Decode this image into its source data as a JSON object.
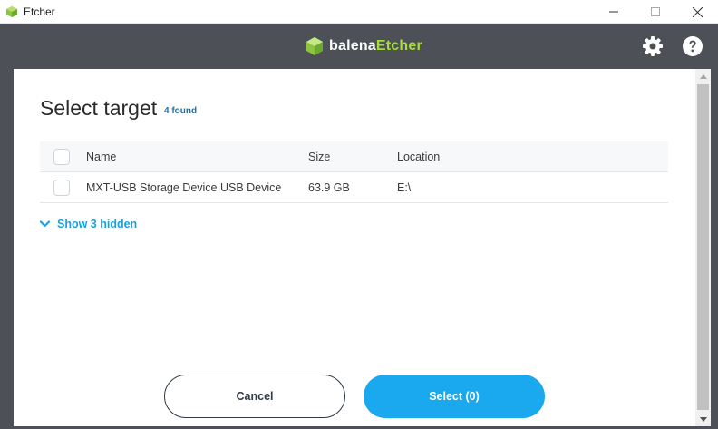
{
  "window": {
    "title": "Etcher",
    "minimize_icon": "minimize-icon",
    "maximize_icon": "maximize-icon",
    "close_icon": "close-icon"
  },
  "header": {
    "brand_left": "balena",
    "brand_right": "Etcher",
    "settings_icon": "gear-icon",
    "help_icon": "help-icon",
    "colors": {
      "bg": "#4d5057",
      "brand_accent": "#a5de37"
    }
  },
  "modal": {
    "title": "Select target",
    "found_label": "4 found",
    "columns": {
      "name": "Name",
      "size": "Size",
      "location": "Location"
    },
    "rows": [
      {
        "name": "MXT-USB Storage Device USB Device",
        "size": "63.9 GB",
        "location": "E:\\"
      }
    ],
    "show_hidden_label": "Show 3 hidden",
    "cancel_label": "Cancel",
    "select_label": "Select (0)",
    "colors": {
      "primary": "#1aa8ef",
      "link": "#1a9fe0"
    }
  }
}
